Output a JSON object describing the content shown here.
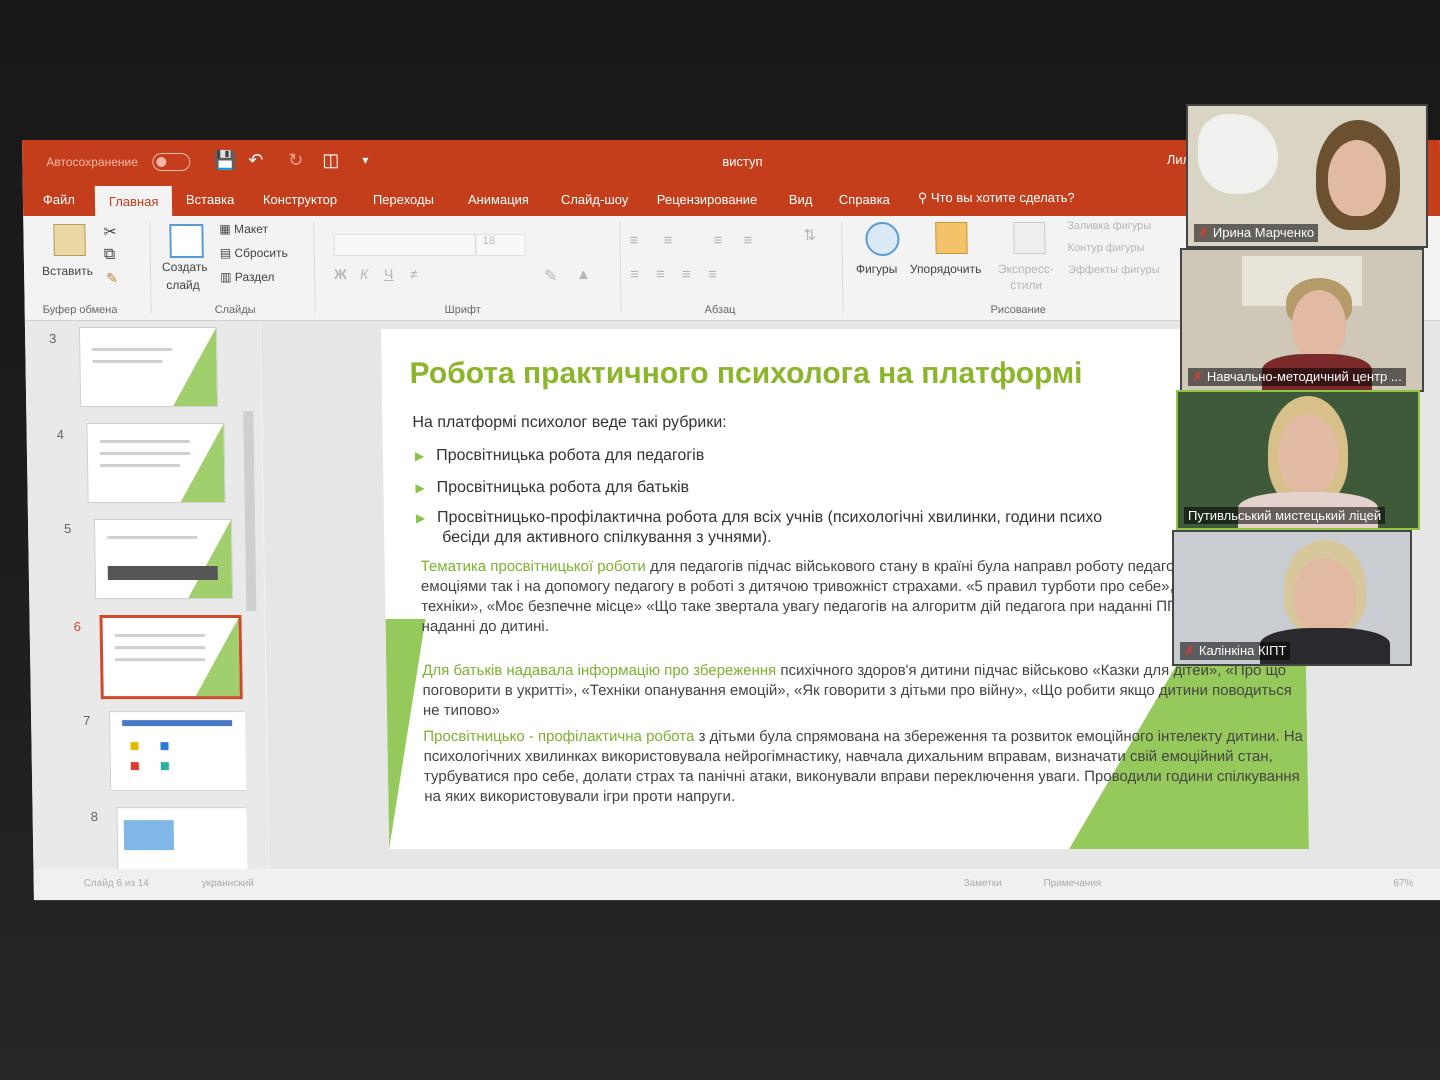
{
  "app": {
    "autosave_label": "Автосохранение",
    "doc_title": "виступ",
    "user_short": "Лил"
  },
  "tabs": [
    "Файл",
    "Главная",
    "Вставка",
    "Конструктор",
    "Переходы",
    "Анимация",
    "Слайд-шоу",
    "Рецензирование",
    "Вид",
    "Справка"
  ],
  "tellme": "Что вы хотите сделать?",
  "ribbon": {
    "paste": "Вставить",
    "clipboard_group": "Буфер обмена",
    "new_slide_line1": "Создать",
    "new_slide_line2": "слайд",
    "layout": "Макет",
    "reset": "Сбросить",
    "section": "Раздел",
    "slides_group": "Слайды",
    "font_size": "18",
    "font_group": "Шрифт",
    "paragraph_group": "Абзац",
    "shapes": "Фигуры",
    "arrange": "Упорядочить",
    "quick_styles_line1": "Экспресс-",
    "quick_styles_line2": "стили",
    "shape_fill": "Заливка фигуры",
    "shape_outline": "Контур фигуры",
    "shape_effects": "Эффекты фигуры",
    "drawing_group": "Рисование"
  },
  "thumbnails": [
    {
      "num": "3"
    },
    {
      "num": "4"
    },
    {
      "num": "5"
    },
    {
      "num": "6"
    },
    {
      "num": "7"
    },
    {
      "num": "8"
    }
  ],
  "slide": {
    "title": "Робота практичного психолога на платформі",
    "intro": "На платформі психолог веде такі рубрики:",
    "bullets": [
      "Просвітницька робота для педагогів",
      "Просвітницька робота для батьків",
      "Просвітницько-профілактична робота для всіх учнів (психологічні хвилинки, години психо",
      "бесіди для  активного спілкування з учнями)."
    ],
    "p1_highlight": "Тематика просвітницької роботи",
    "p1_text": " для педагогів підчас військового стану в країні була направл роботу педагога зі своїми емоціями так і на допомогу педагогу в роботі з дитячою тривожніст страхами. «5 правил турботи про себе», «Дихальні техніки», «Моє безпечне місце» «Що таке звертала увагу педагогів на алгоритм дій педагога при наданні ППД з протоколами наданні до дитині.",
    "p2_highlight": "Для батьків надавала інформацію про збереження",
    "p2_text": " психічного здоров'я дитини підчас військово «Казки для дітей», «Про що поговорити в укритті», «Техніки опанування емоцій», «Як говорити з дітьми про війну», «Що робити якщо дитини поводиться не типово»",
    "p3_highlight": "Просвітницько - профілактична робота",
    "p3_text": "  з дітьми була спрямована на збереження та розвиток емоційного інтелекту дитини. На психологічних хвилинках використовувала нейрогімнастику, навчала дихальним вправам, визначати свій емоційний стан, турбуватися про себе, долати страх та панічні атаки, виконували вправи переключення уваги. Проводили години спілкування на яких використовували ігри проти напруги."
  },
  "statusbar": {
    "slide_info": "Слайд 6 из 14",
    "language": "украинский",
    "notes": "Заметки",
    "comments": "Примечания",
    "zoom": "67%"
  },
  "participants": [
    {
      "name": "Ирина Марченко"
    },
    {
      "name": "Навчально-методичний центр ..."
    },
    {
      "name": "Путивльський мистецький ліцей"
    },
    {
      "name": "Калінкіна КІПТ"
    }
  ],
  "colors": {
    "accent": "#c43e1c",
    "slide_green": "#8bc34a",
    "speaking_border": "#8ec63f"
  }
}
